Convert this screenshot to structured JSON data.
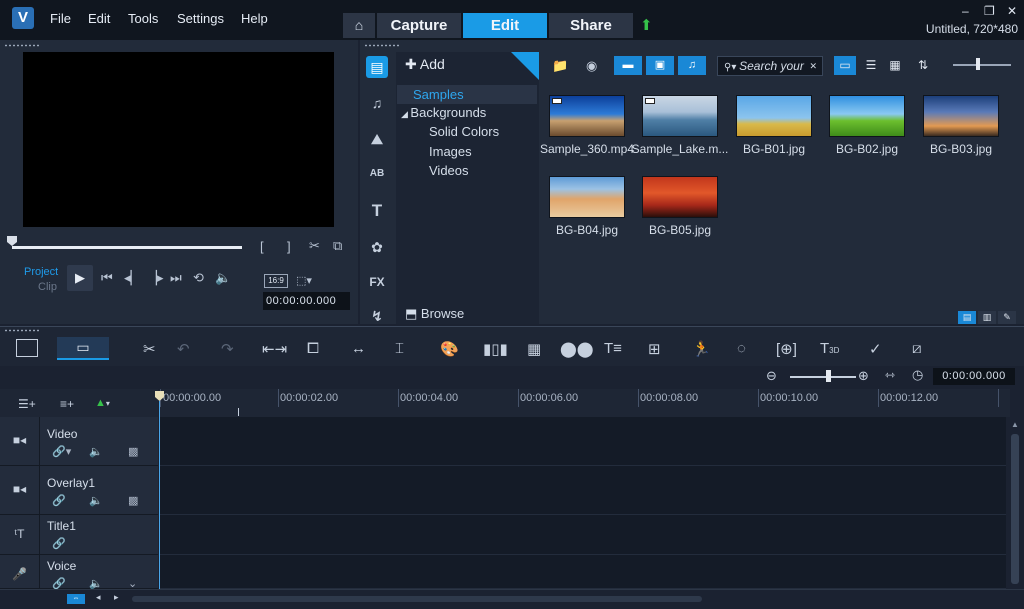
{
  "window": {
    "logo": "V",
    "project_info": "Untitled, 720*480",
    "controls": {
      "minimize": "–",
      "restore": "❐",
      "close": "✕"
    }
  },
  "menu": [
    "File",
    "Edit",
    "Tools",
    "Settings",
    "Help"
  ],
  "workspace_tabs": {
    "home": "⌂",
    "capture": "Capture",
    "edit": "Edit",
    "share": "Share",
    "upload": "⬆"
  },
  "player": {
    "project_label": "Project",
    "clip_label": "Clip",
    "play": "▶",
    "aspect": "16:9",
    "timecode": "00:00:00.000"
  },
  "library": {
    "add_label": "Add",
    "tree": {
      "samples": "Samples",
      "backgrounds": "Backgrounds",
      "children": [
        "Solid Colors",
        "Images",
        "Videos"
      ]
    },
    "browse_label": "Browse",
    "search_placeholder": "Search your",
    "items": [
      {
        "label": "Sample_360.mp4",
        "kind": "video"
      },
      {
        "label": "Sample_Lake.m...",
        "kind": "video"
      },
      {
        "label": "BG-B01.jpg",
        "kind": "image"
      },
      {
        "label": "BG-B02.jpg",
        "kind": "image"
      },
      {
        "label": "BG-B03.jpg",
        "kind": "image"
      },
      {
        "label": "BG-B04.jpg",
        "kind": "image"
      },
      {
        "label": "BG-B05.jpg",
        "kind": "image"
      }
    ]
  },
  "timeline": {
    "timecode": "0:00:00.000",
    "ruler": [
      "00:00:00.00",
      "00:00:02.00",
      "00:00:04.00",
      "00:00:06.00",
      "00:00:08.00",
      "00:00:10.00",
      "00:00:12.00"
    ],
    "tracks": [
      {
        "name": "Video"
      },
      {
        "name": "Overlay1"
      },
      {
        "name": "Title1"
      },
      {
        "name": "Voice"
      }
    ]
  },
  "colors": {
    "accent": "#1a9be6",
    "background": "#1b2231",
    "panel": "#222b3a"
  }
}
